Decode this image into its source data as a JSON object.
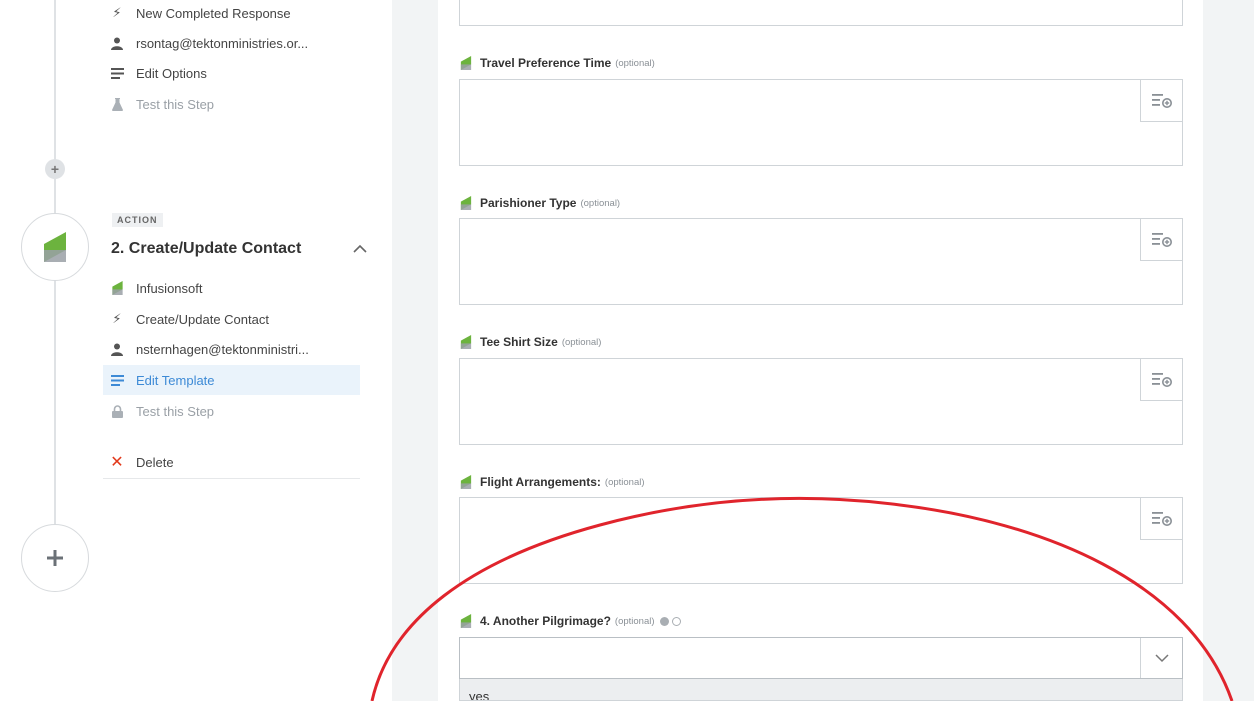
{
  "sidebar": {
    "trigger_items": [
      {
        "icon": "lightning-icon",
        "label": "New Completed Response"
      },
      {
        "icon": "user-icon",
        "label": "rsontag@tektonministries.or..."
      },
      {
        "icon": "list-icon",
        "label": "Edit Options"
      },
      {
        "icon": "flask-icon",
        "label": "Test this Step"
      }
    ],
    "action_step": {
      "badge": "ACTION",
      "title": "2. Create/Update Contact",
      "items": [
        {
          "icon": "infusionsoft-logo",
          "label": "Infusionsoft"
        },
        {
          "icon": "lightning-icon",
          "label": "Create/Update Contact"
        },
        {
          "icon": "user-icon",
          "label": "nsternhagen@tektonministri..."
        },
        {
          "icon": "list-icon",
          "label": "Edit Template"
        },
        {
          "icon": "lock-icon",
          "label": "Test this Step"
        }
      ],
      "delete_label": "Delete"
    }
  },
  "form": {
    "fields": [
      {
        "label": "Travel Preference Time",
        "optional": "(optional)"
      },
      {
        "label": "Parishioner Type",
        "optional": "(optional)"
      },
      {
        "label": "Tee Shirt Size",
        "optional": "(optional)"
      },
      {
        "label": "Flight Arrangements:",
        "optional": "(optional)"
      }
    ],
    "select_field": {
      "label": "4. Another Pilgrimage?",
      "optional": "(optional)",
      "value": "",
      "dropdown_option": "yes"
    }
  },
  "colors": {
    "accent_blue": "#3d8ad6",
    "annotation_red": "#e0242c",
    "delete_red": "#e2391b",
    "infusionsoft_green": "#6cb33e"
  }
}
